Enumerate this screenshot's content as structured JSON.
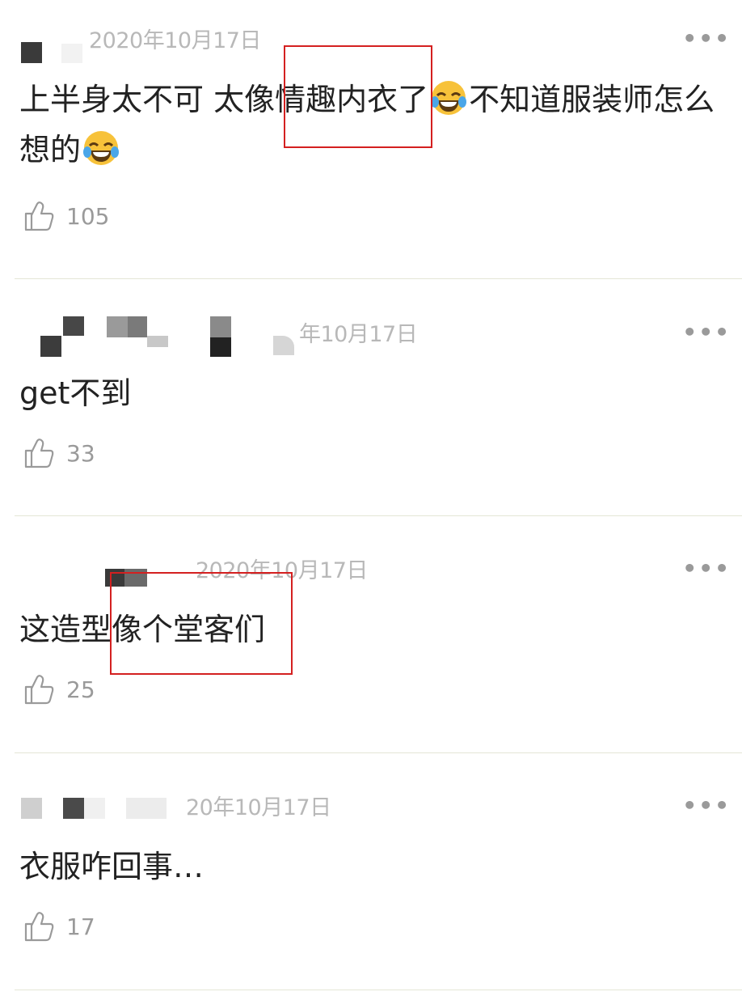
{
  "comments": [
    {
      "date": "2020年10月17日",
      "text_before": "上半身太不可 太像情趣内衣了",
      "text_middle": "不知道服装师怎么想的",
      "like_count": "105",
      "emoji": "face-with-tears-of-joy"
    },
    {
      "date": "年10月17日",
      "text": "get不到",
      "like_count": "33"
    },
    {
      "date": "2020年10月17日",
      "text": "这造型像个堂客们",
      "like_count": "25"
    },
    {
      "date": "20年10月17日",
      "text": "衣服咋回事…",
      "like_count": "17"
    }
  ],
  "icons": {
    "more": "more-dots-icon",
    "like": "thumbs-up-icon"
  },
  "colors": {
    "highlight_box": "#d42020",
    "text": "#222222",
    "meta": "#b8b8b8",
    "divider": "#e4e6d6"
  },
  "more_glyph": "•••"
}
